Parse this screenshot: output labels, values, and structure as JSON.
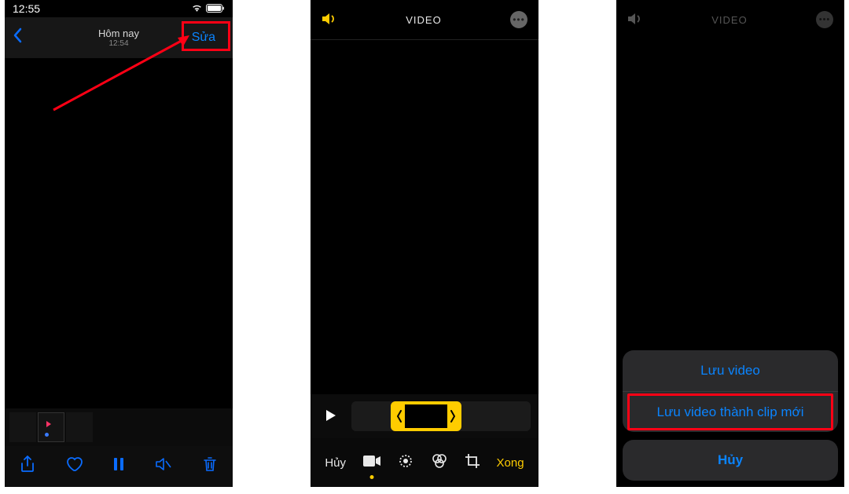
{
  "screen1": {
    "status_time": "12:55",
    "nav_title": "Hôm nay",
    "nav_subtitle": "12:54",
    "edit_label": "Sửa"
  },
  "screen2": {
    "title": "VIDEO",
    "cancel_label": "Hủy",
    "done_label": "Xong"
  },
  "screen3": {
    "title": "VIDEO",
    "save_video_label": "Lưu video",
    "save_clip_label": "Lưu video thành clip mới",
    "cancel_label": "Hủy"
  },
  "colors": {
    "accent_blue": "#0a84ff",
    "accent_yellow": "#ffcc00",
    "annotation_red": "#ff0015"
  }
}
